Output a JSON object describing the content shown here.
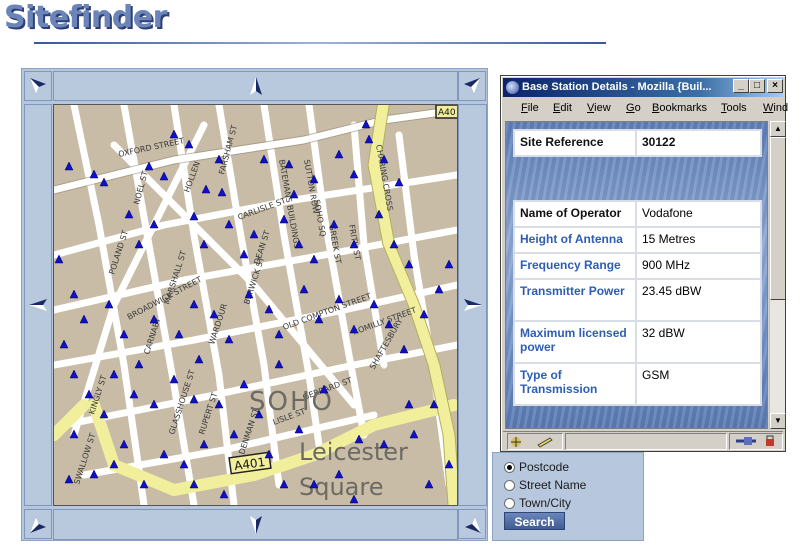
{
  "site": {
    "logo_text": "Sitefinder"
  },
  "map": {
    "area_label": "SOHO",
    "square_label_1": "Leicester",
    "square_label_2": "Square",
    "road_label": "A401",
    "road_label_2": "A40",
    "streets": [
      "OXFORD STREET",
      "NOEL ST",
      "HOLLEN",
      "FARSHAM ST",
      "CARLISLE ST",
      "SUTTON ROW",
      "CHARING CROSS",
      "BATEMANS BUILDINGS",
      "FRITH ST",
      "GREEK ST",
      "DEAN ST",
      "SOHO SQ",
      "BROADWICK STREET",
      "OLD COMPTON STREET",
      "ROMILLY STREET",
      "SHAFTESBURY",
      "GERRARD ST",
      "LISLE ST",
      "BERWICK ST",
      "WARDOUR",
      "CARNABY",
      "KINGLY ST",
      "MARSHALL ST",
      "POLAND ST",
      "RUPERT ST",
      "DENMAN ST",
      "GLASSHOUSE ST",
      "SWALLOW ST"
    ]
  },
  "search": {
    "options": [
      "Postcode",
      "Street Name",
      "Town/City"
    ],
    "selected": "Postcode",
    "button_label": "Search"
  },
  "window": {
    "title": "Base Station Details - Mozilla {Buil...",
    "menu": [
      "File",
      "Edit",
      "View",
      "Go",
      "Bookmarks",
      "Tools",
      "Wind"
    ],
    "site_reference_label": "Site Reference",
    "site_reference_value": "30122",
    "details": [
      {
        "label": "Name of Operator",
        "value": "Vodafone",
        "style": "dark"
      },
      {
        "label": "Height of Antenna",
        "value": "15 Metres",
        "style": "blue"
      },
      {
        "label": "Frequency Range",
        "value": "900 MHz",
        "style": "blue"
      },
      {
        "label": "Transmitter Power",
        "value": "23.45 dBW",
        "style": "blue"
      },
      {
        "label": "Maximum licensed power",
        "value": "32 dBW",
        "style": "blue"
      },
      {
        "label": "Type of Transmission",
        "value": "GSM",
        "style": "blue"
      }
    ]
  },
  "colors": {
    "marker": "#1010c8",
    "map_bg": "#c8bca7",
    "road_major": "#f2ef9c",
    "road_minor": "#ffffff",
    "frame": "#b8c9de"
  }
}
